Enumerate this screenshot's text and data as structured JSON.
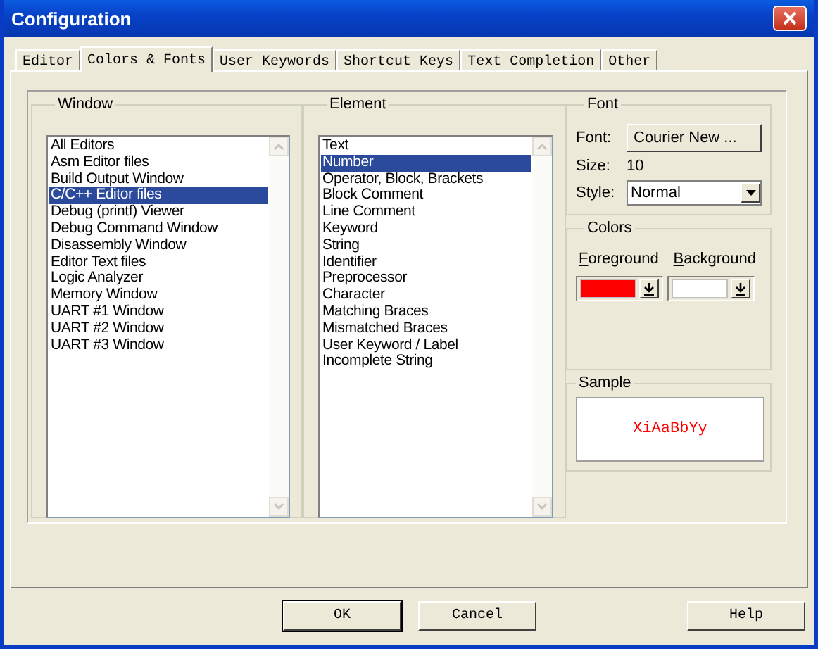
{
  "window": {
    "title": "Configuration"
  },
  "tabs": [
    {
      "label": "Editor",
      "selected": false
    },
    {
      "label": "Colors & Fonts",
      "selected": true
    },
    {
      "label": "User Keywords",
      "selected": false
    },
    {
      "label": "Shortcut Keys",
      "selected": false
    },
    {
      "label": "Text Completion",
      "selected": false
    },
    {
      "label": "Other",
      "selected": false
    }
  ],
  "window_group": {
    "title": "Window",
    "items": [
      {
        "label": "All Editors",
        "selected": false
      },
      {
        "label": "Asm Editor files",
        "selected": false
      },
      {
        "label": "Build Output Window",
        "selected": false
      },
      {
        "label": "C/C++ Editor files",
        "selected": true
      },
      {
        "label": "Debug (printf) Viewer",
        "selected": false
      },
      {
        "label": "Debug Command Window",
        "selected": false
      },
      {
        "label": "Disassembly Window",
        "selected": false
      },
      {
        "label": "Editor Text files",
        "selected": false
      },
      {
        "label": "Logic Analyzer",
        "selected": false
      },
      {
        "label": "Memory Window",
        "selected": false
      },
      {
        "label": "UART #1 Window",
        "selected": false
      },
      {
        "label": "UART #2 Window",
        "selected": false
      },
      {
        "label": "UART #3 Window",
        "selected": false
      }
    ]
  },
  "element_group": {
    "title": "Element",
    "items": [
      {
        "label": "Text",
        "selected": false
      },
      {
        "label": "Number",
        "selected": true
      },
      {
        "label": "Operator, Block, Brackets",
        "selected": false
      },
      {
        "label": "Block Comment",
        "selected": false
      },
      {
        "label": "Line Comment",
        "selected": false
      },
      {
        "label": "Keyword",
        "selected": false
      },
      {
        "label": "String",
        "selected": false
      },
      {
        "label": "Identifier",
        "selected": false
      },
      {
        "label": "Preprocessor",
        "selected": false
      },
      {
        "label": "Character",
        "selected": false
      },
      {
        "label": "Matching Braces",
        "selected": false
      },
      {
        "label": "Mismatched Braces",
        "selected": false
      },
      {
        "label": "User Keyword / Label",
        "selected": false
      },
      {
        "label": "Incomplete String",
        "selected": false
      }
    ]
  },
  "font": {
    "title": "Font",
    "font_label": "Font:",
    "font_button": "Courier New ...",
    "size_label": "Size:",
    "size_value": "10",
    "style_label": "Style:",
    "style_value": "Normal"
  },
  "colors": {
    "title": "Colors",
    "swatches": [
      {
        "label": "Foreground",
        "color": "#ff0000"
      },
      {
        "label": "Background",
        "color": "#ffffff"
      }
    ]
  },
  "sample": {
    "title": "Sample",
    "text": "XiAaBbYy"
  },
  "buttons": [
    "OK",
    "Cancel",
    "Help"
  ]
}
